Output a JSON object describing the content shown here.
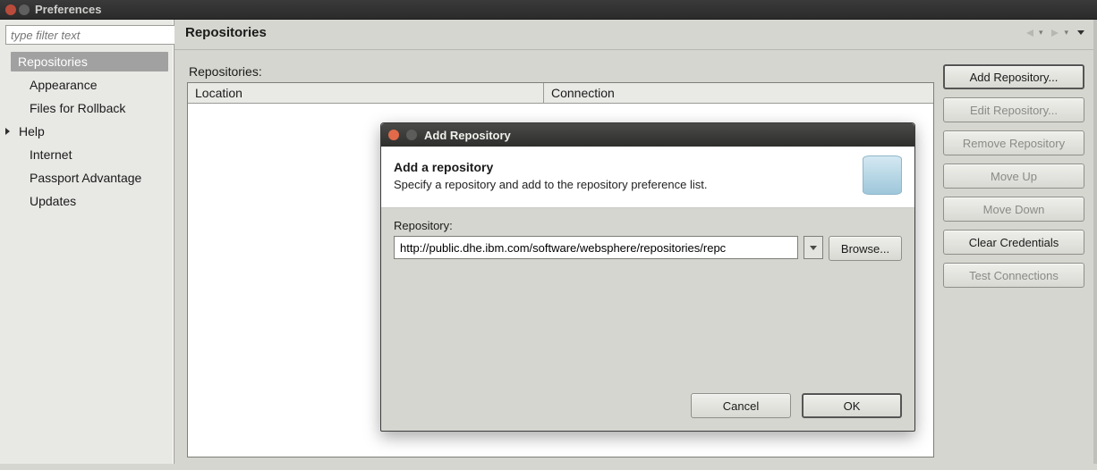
{
  "window": {
    "title": "Preferences"
  },
  "filter": {
    "placeholder": "type filter text"
  },
  "sidebar": {
    "items": [
      {
        "label": "Repositories",
        "selected": true,
        "has_children": false
      },
      {
        "label": "Appearance",
        "selected": false,
        "has_children": false
      },
      {
        "label": "Files for Rollback",
        "selected": false,
        "has_children": false
      },
      {
        "label": "Help",
        "selected": false,
        "has_children": true
      },
      {
        "label": "Internet",
        "selected": false,
        "has_children": false
      },
      {
        "label": "Passport Advantage",
        "selected": false,
        "has_children": false
      },
      {
        "label": "Updates",
        "selected": false,
        "has_children": false
      }
    ]
  },
  "main": {
    "title": "Repositories",
    "table_label": "Repositories:",
    "columns": {
      "location": "Location",
      "connection": "Connection"
    },
    "buttons": {
      "add": "Add Repository...",
      "edit": "Edit Repository...",
      "remove": "Remove Repository",
      "up": "Move Up",
      "down": "Move Down",
      "clear": "Clear Credentials",
      "test": "Test Connections"
    }
  },
  "dialog": {
    "title": "Add Repository",
    "head_title": "Add a repository",
    "head_sub": "Specify a repository and add to the repository preference list.",
    "field_label": "Repository:",
    "value": "http://public.dhe.ibm.com/software/websphere/repositories/repc",
    "browse": "Browse...",
    "cancel": "Cancel",
    "ok": "OK"
  }
}
